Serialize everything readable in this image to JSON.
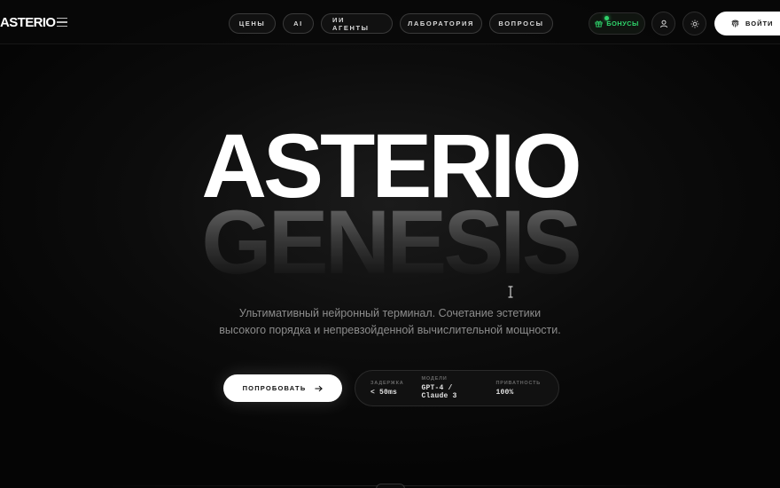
{
  "header": {
    "logo": "ASTERIO",
    "nav": [
      "ЦЕНЫ",
      "AI",
      "ИИ АГЕНТЫ",
      "ЛАБОРАТОРИЯ",
      "ВОПРОСЫ"
    ],
    "bonus_label": "БОНУСЫ",
    "login_label": "ВОЙТИ"
  },
  "hero": {
    "title_line1": "ASTERIO",
    "title_line2": "GENESIS",
    "subtitle_line1": "Ультимативный нейронный терминал. Сочетание эстетики",
    "subtitle_line2": "высокого порядка и непревзойденной вычислительной мощности.",
    "cta_label": "ПОПРОБОВАТЬ"
  },
  "stats": [
    {
      "label": "ЗАДЕРЖКА",
      "value": "< 50ms"
    },
    {
      "label": "МОДЕЛИ",
      "value": "GPT-4 / Claude 3"
    },
    {
      "label": "ПРИВАТНОСТЬ",
      "value": "100%"
    }
  ],
  "colors": {
    "accent_green": "#2fd36b",
    "background": "#050505",
    "text_primary": "#ffffff",
    "text_muted": "#8c8c8c"
  },
  "icons": {
    "menu": "hamburger-menu-icon",
    "bonus": "gift-icon",
    "profile": "user-icon",
    "theme": "sun-icon",
    "login": "fingerprint-icon",
    "cta": "arrow-right-icon"
  }
}
